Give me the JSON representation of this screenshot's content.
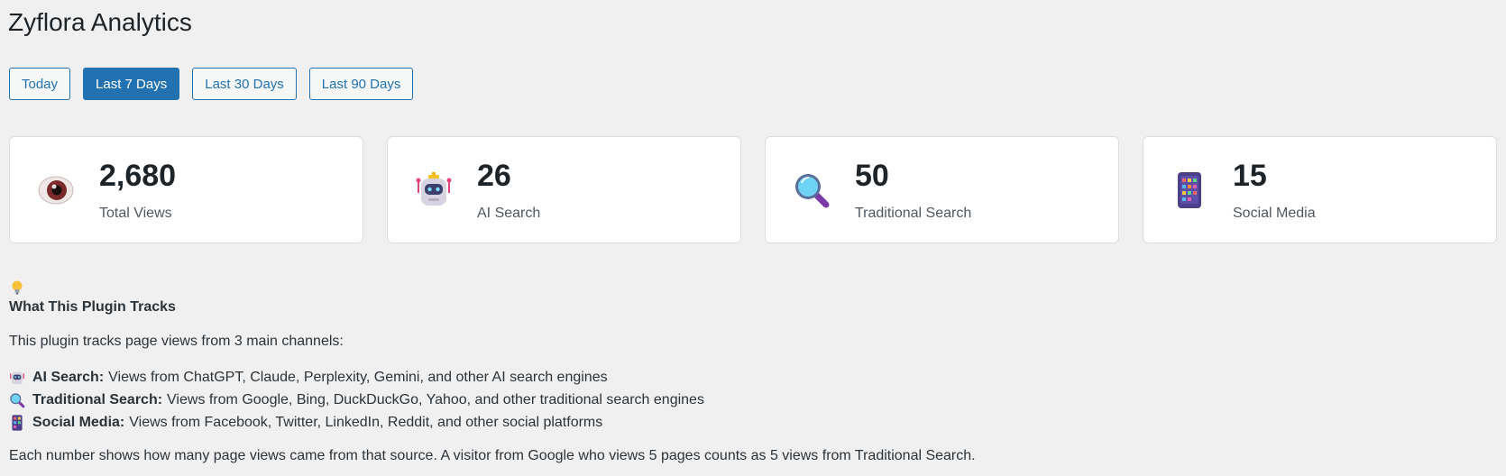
{
  "app": {
    "title": "Zyflora Analytics"
  },
  "filters": [
    {
      "label": "Today",
      "active": false
    },
    {
      "label": "Last 7 Days",
      "active": true
    },
    {
      "label": "Last 30 Days",
      "active": false
    },
    {
      "label": "Last 90 Days",
      "active": false
    }
  ],
  "cards": [
    {
      "icon": "eye-icon",
      "value": "2,680",
      "label": "Total Views"
    },
    {
      "icon": "robot-icon",
      "value": "26",
      "label": "AI Search"
    },
    {
      "icon": "magnifier-icon",
      "value": "50",
      "label": "Traditional Search"
    },
    {
      "icon": "mobile-phone-icon",
      "value": "15",
      "label": "Social Media"
    }
  ],
  "info": {
    "icon": "lightbulb-icon",
    "heading": "What This Plugin Tracks",
    "intro": "This plugin tracks page views from 3 main channels:",
    "items": [
      {
        "icon": "robot-icon",
        "name": "AI Search:",
        "desc": "Views from ChatGPT, Claude, Perplexity, Gemini, and other AI search engines"
      },
      {
        "icon": "magnifier-icon",
        "name": "Traditional Search:",
        "desc": "Views from Google, Bing, DuckDuckGo, Yahoo, and other traditional search engines"
      },
      {
        "icon": "mobile-phone-icon",
        "name": "Social Media:",
        "desc": "Views from Facebook, Twitter, LinkedIn, Reddit, and other social platforms"
      }
    ],
    "footer": "Each number shows how many page views came from that source. A visitor from Google who views 5 pages counts as 5 views from Traditional Search."
  },
  "colors": {
    "accent": "#2271b1",
    "background": "#f0f0f1",
    "card": "#ffffff"
  }
}
